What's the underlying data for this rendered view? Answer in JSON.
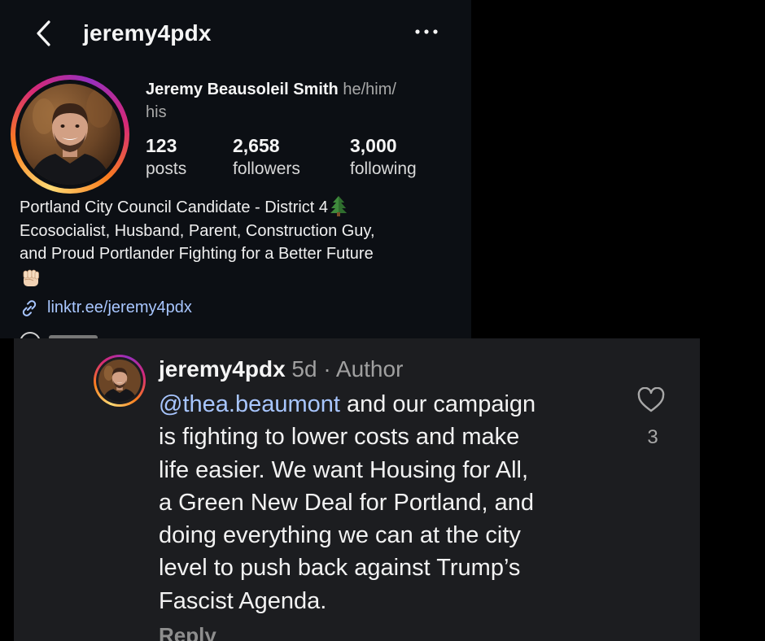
{
  "profile": {
    "handle": "jeremy4pdx",
    "full_name": "Jeremy Beausoleil Smith",
    "pronouns_line1": "he/him/",
    "pronouns_line2": "his",
    "stats": [
      {
        "value": "123",
        "label": "posts"
      },
      {
        "value": "2,658",
        "label": "followers"
      },
      {
        "value": "3,000",
        "label": "following"
      }
    ],
    "bio_lines": [
      "Portland City Council Candidate - District 4",
      "Ecosocialist, Husband, Parent, Construction Guy,",
      "and Proud Portlander Fighting for a Better Future"
    ],
    "link": "linktr.ee/jeremy4pdx",
    "icons": {
      "back": "chevron-left-icon",
      "more": "more-horizontal-icon",
      "tree": "evergreen-tree-emoji",
      "fist": "raised-fist-emoji",
      "link": "link-icon"
    }
  },
  "comment": {
    "username": "jeremy4pdx",
    "meta": " 5d · Author",
    "mention": "@thea.beaumont",
    "line1_rest": " and our campaign",
    "lines": [
      "is fighting to lower costs and make",
      "life easier. We want Housing for All,",
      "a Green New Deal for Portland, and",
      "doing everything we can at the city",
      "level to push back against Trump’s",
      "Fascist Agenda."
    ],
    "likes": "3",
    "reply_label": "Reply",
    "icons": {
      "like": "heart-outline-icon"
    }
  },
  "colors": {
    "profile_bg": "#0c0f14",
    "comment_bg": "#1c1d20",
    "link_blue": "#a8c6ff",
    "story_ring": [
      "#feda75",
      "#fa7e1e",
      "#d62976",
      "#962fbf"
    ]
  }
}
